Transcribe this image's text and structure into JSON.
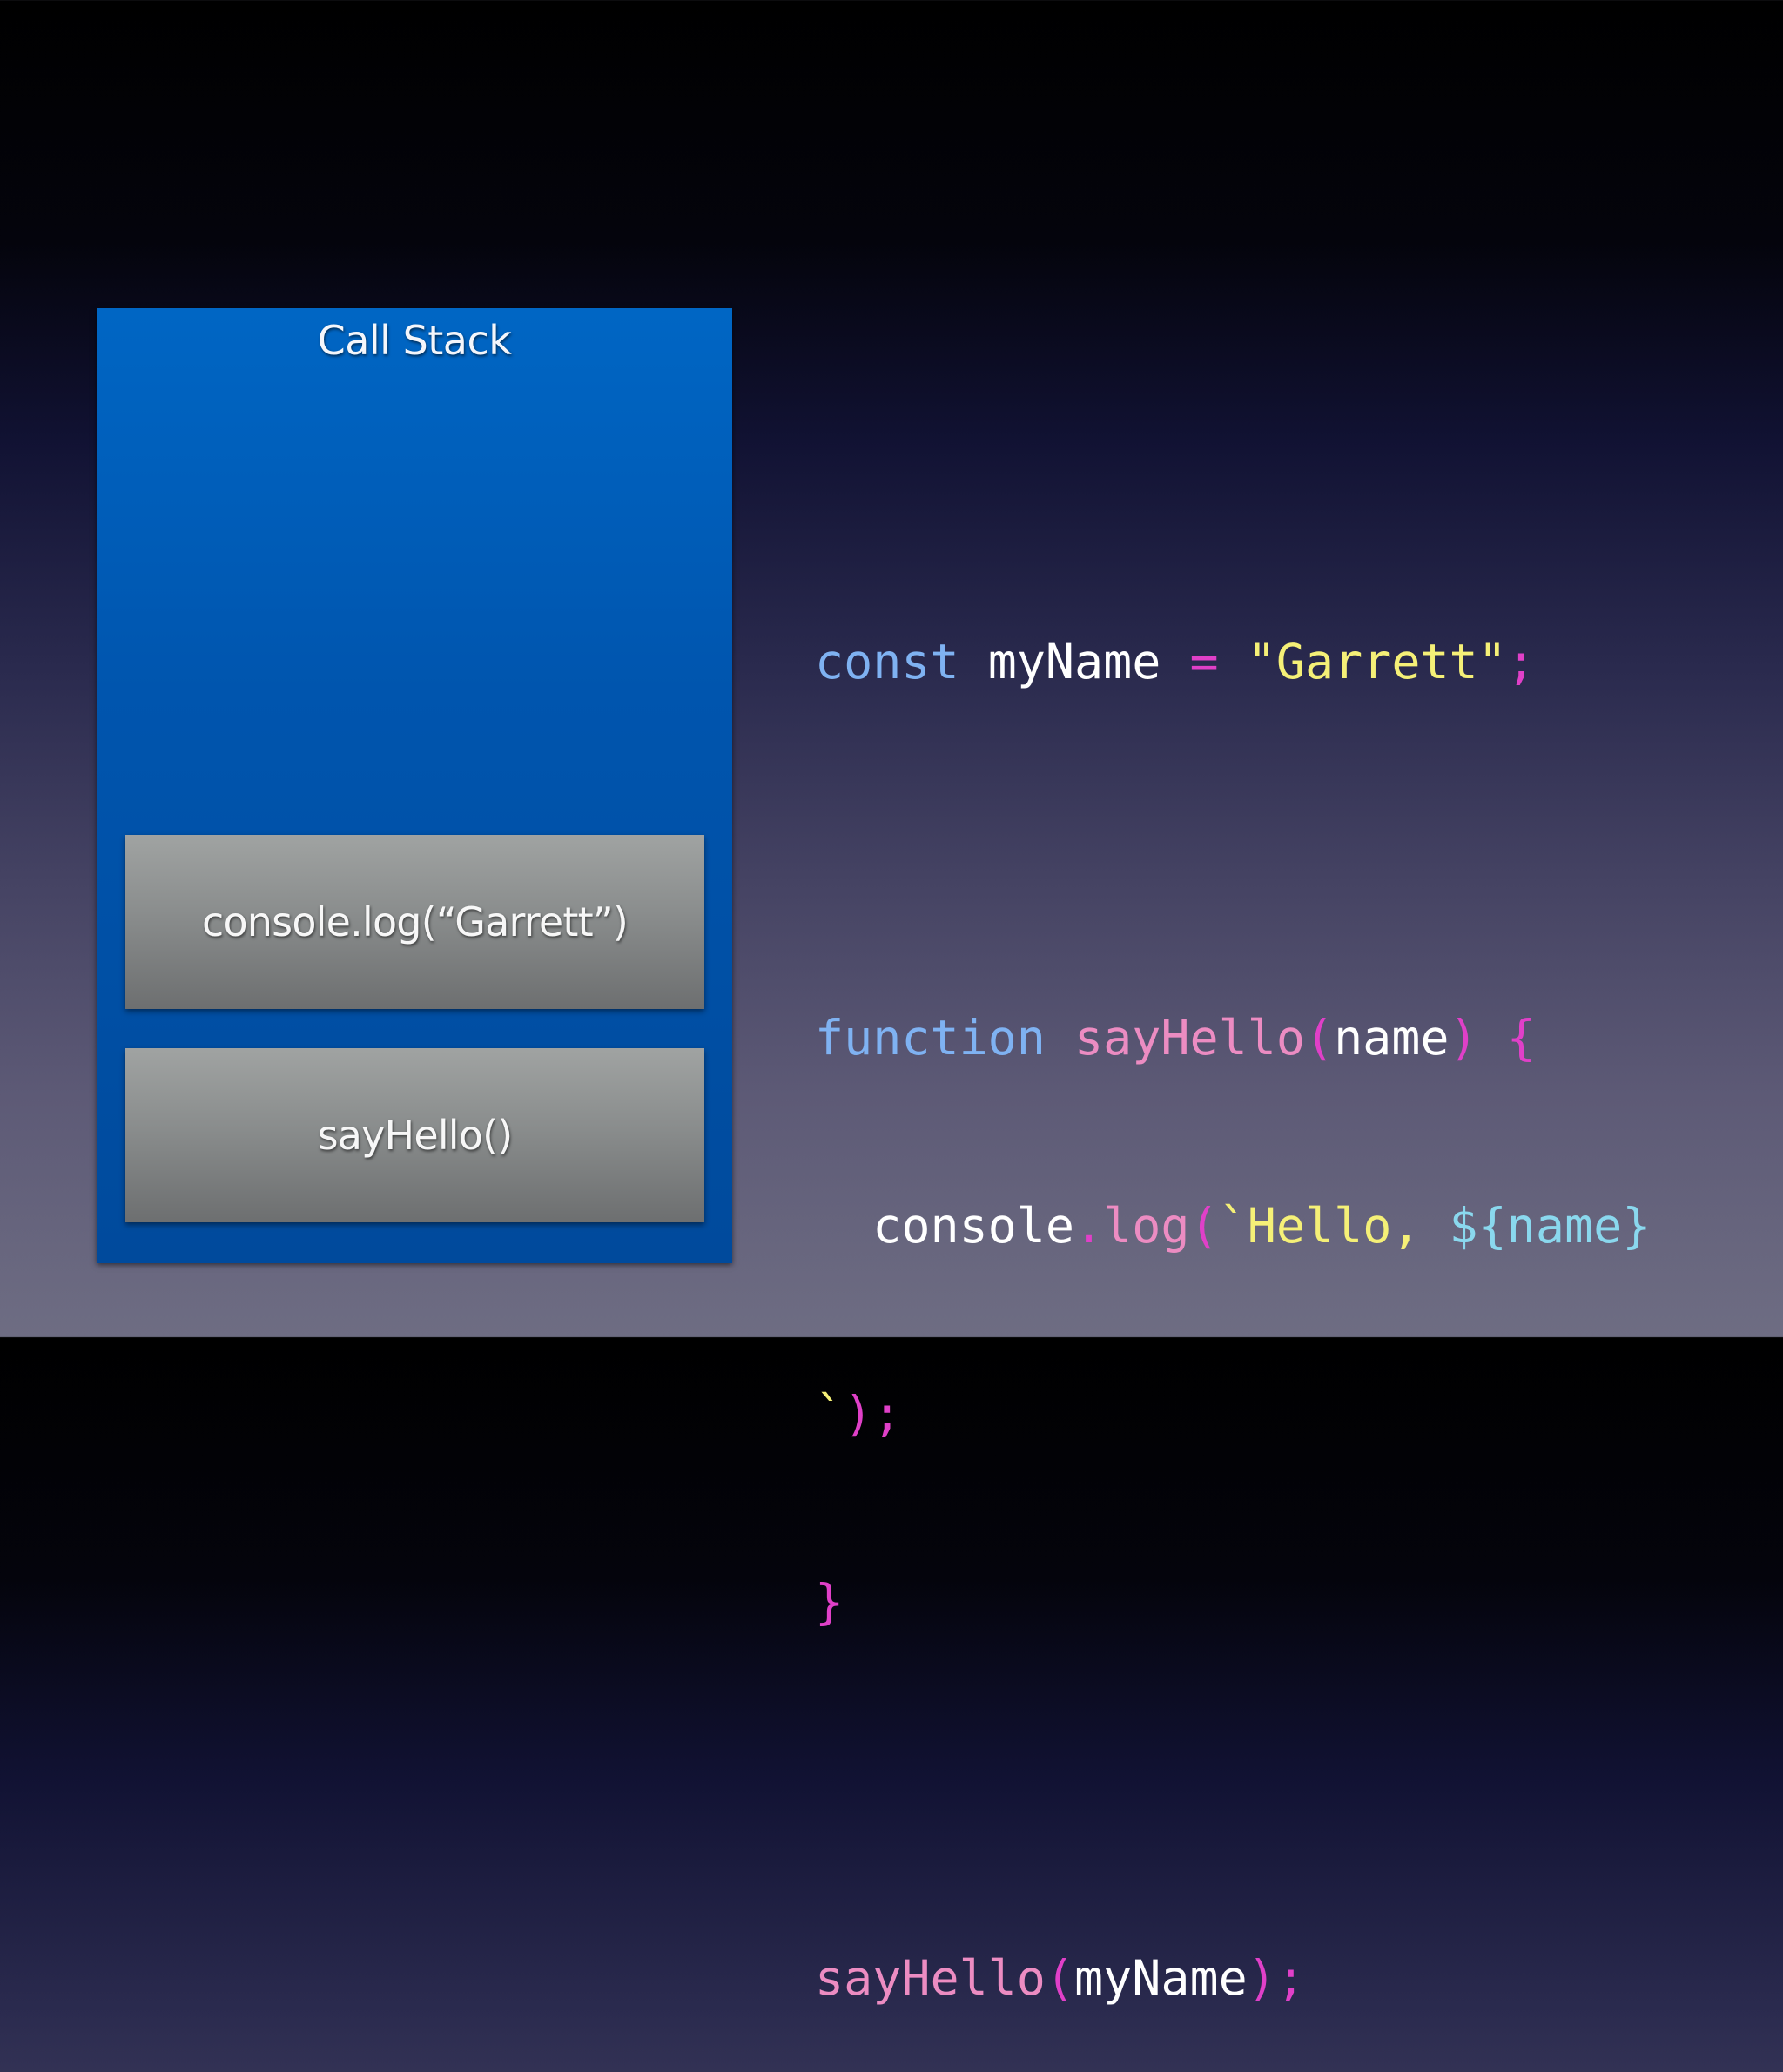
{
  "call_stack": {
    "title": "Call Stack",
    "frames": [
      {
        "label": "console.log(“Garrett”)"
      },
      {
        "label": "sayHello()"
      }
    ]
  },
  "code": {
    "line1": {
      "kw": "const",
      "sp1": " ",
      "var": "myName",
      "sp2": " ",
      "eq": "=",
      "sp3": " ",
      "str": "\"Garrett\"",
      "semi": ";"
    },
    "line3": {
      "kw": "function",
      "sp1": " ",
      "fn": "sayHello",
      "lparen": "(",
      "param": "name",
      "rparen": ")",
      "sp2": " ",
      "brace": "{"
    },
    "line4": {
      "indent": "  ",
      "obj": "console",
      "dot": ".",
      "method": "log",
      "lparen": "(",
      "tick": "`",
      "str": "Hello, ",
      "interp_open": "${",
      "interp_var": "name",
      "interp_close": "}"
    },
    "line5": {
      "tick": "`",
      "rparen": ")",
      "semi": ";"
    },
    "line6": {
      "brace": "}"
    },
    "line8": {
      "fn": "sayHello",
      "lparen": "(",
      "arg": "myName",
      "rparen": ")",
      "semi": ";"
    }
  }
}
